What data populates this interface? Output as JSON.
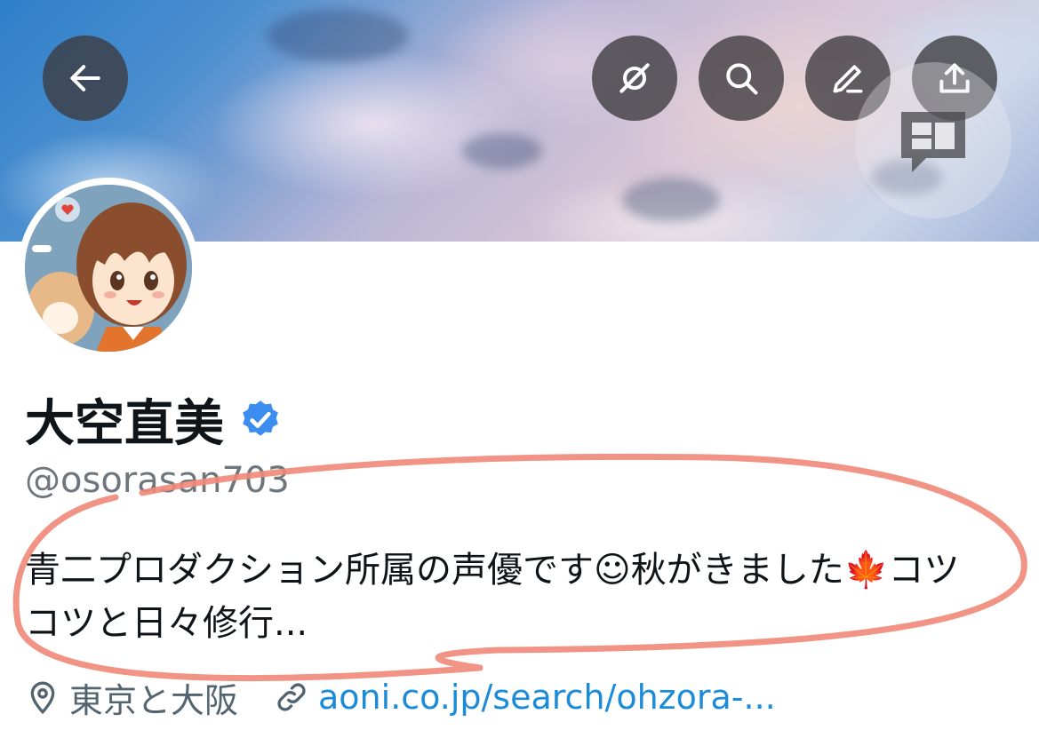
{
  "profile": {
    "display_name": "大空直美",
    "handle": "@osorasan703",
    "bio_line1": "青二プロダクション所属の声優です☺秋がきました🍁コツ",
    "bio_line2": "コツと日々修行...",
    "location": "東京と大阪",
    "website": "aoni.co.jp/search/ohzora-..."
  },
  "icons": {
    "back": "arrow-left-icon",
    "grok": "grok-slash-icon",
    "search": "search-icon",
    "edit": "pencil-icon",
    "share": "share-upload-icon",
    "verified": "verified-badge-icon",
    "location": "location-pin-icon",
    "link": "link-icon"
  },
  "colors": {
    "verified": "#3b8ef0",
    "link": "#1d8cd8",
    "annotation": "#f08878"
  }
}
